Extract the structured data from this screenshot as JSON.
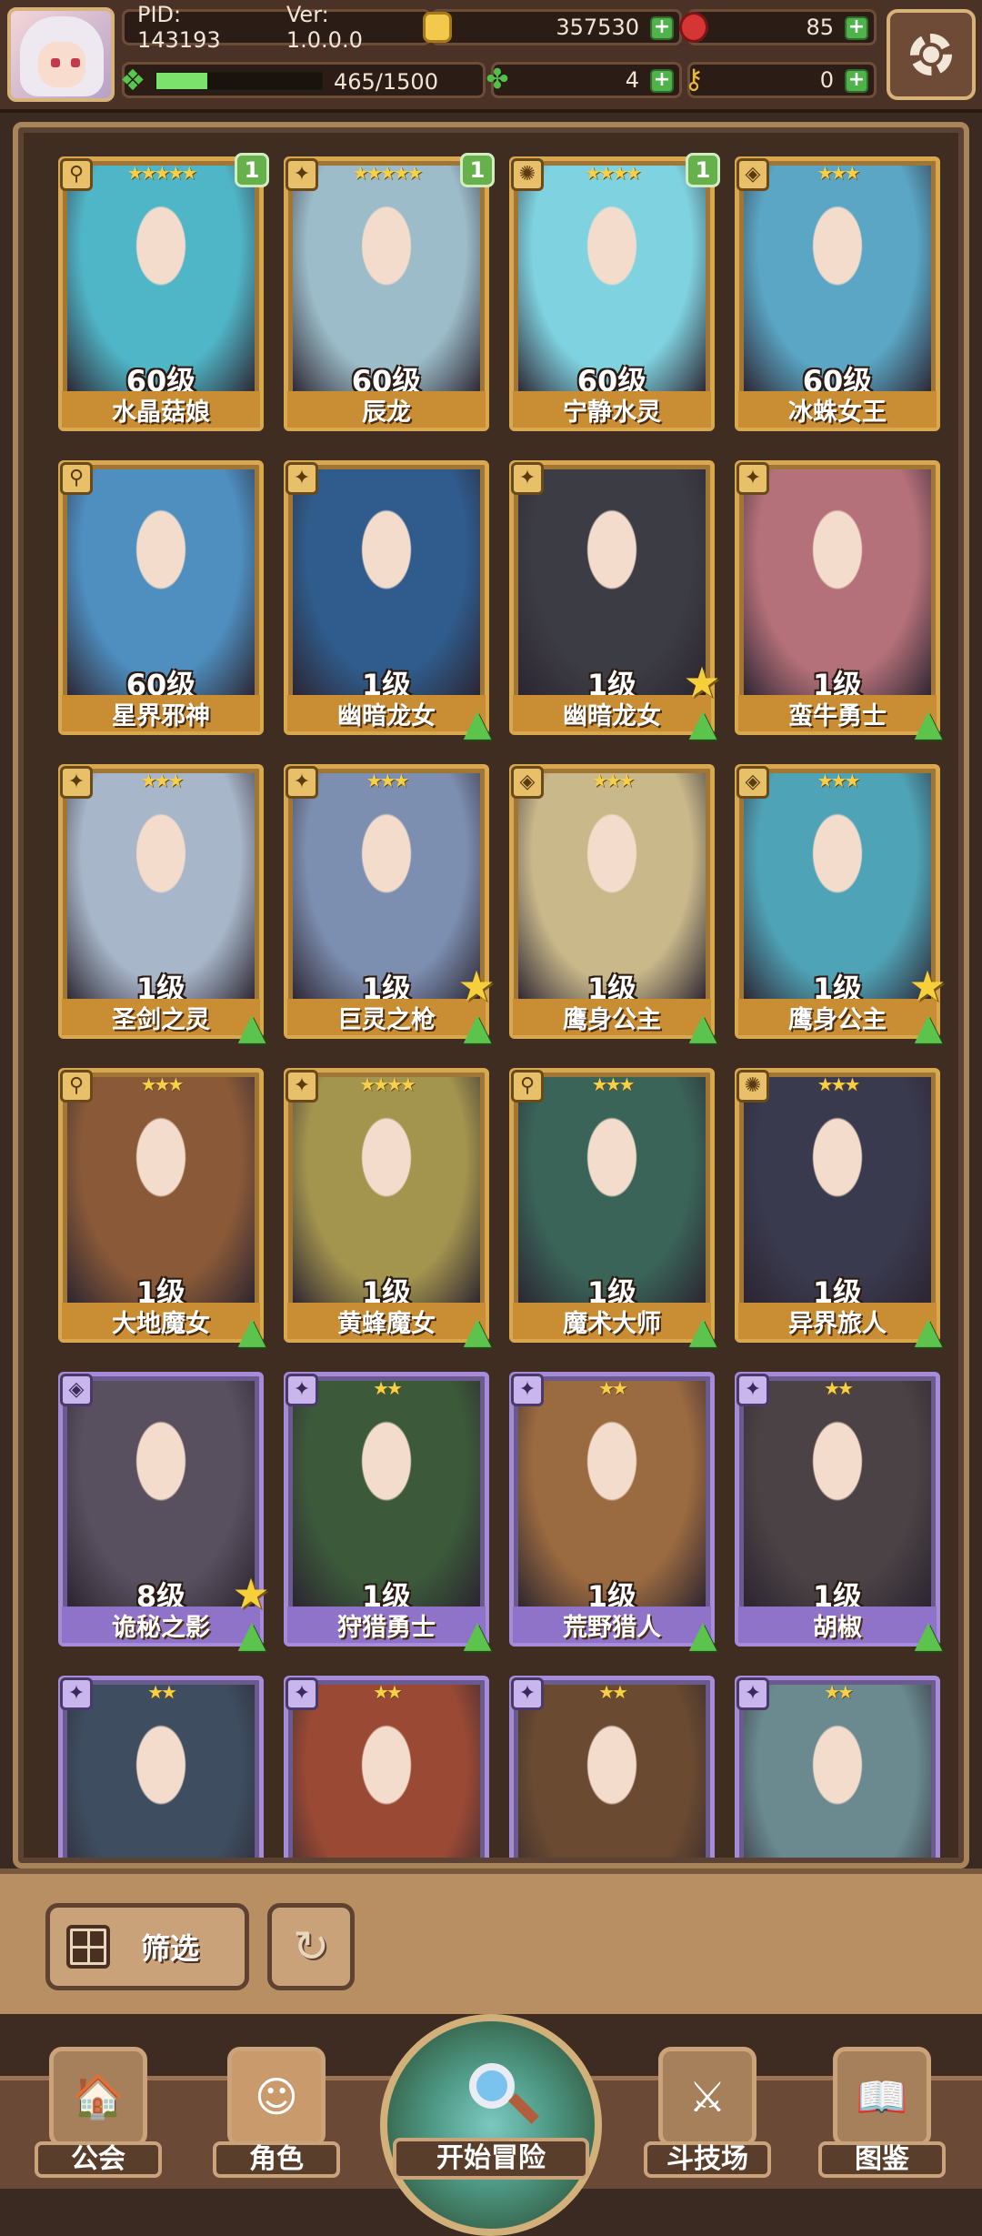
{
  "header": {
    "pid_label": "PID: 143193",
    "version_label": "Ver: 1.0.0.0",
    "coins": "357530",
    "gems": "85",
    "energy": "465/1500",
    "energy_fraction": 0.31,
    "clovers": "4",
    "keys": "0",
    "icons": {
      "coin": "coin-icon",
      "gem": "gem-icon",
      "energy": "leaf-icon",
      "clover": "clover-icon",
      "key": "key-icon",
      "settings": "gear-icon"
    }
  },
  "cards": [
    {
      "name": "水晶菇娘",
      "level": "60级",
      "stars": 5,
      "badge": "1",
      "role": "wand",
      "color": "gold",
      "tint": "#4fb6c7",
      "up": false,
      "bigstar": false
    },
    {
      "name": "辰龙",
      "level": "60级",
      "stars": 5,
      "badge": "1",
      "role": "sword",
      "color": "gold",
      "tint": "#9bbcc8",
      "up": false,
      "bigstar": false
    },
    {
      "name": "宁静水灵",
      "level": "60级",
      "stars": 4,
      "badge": "1",
      "role": "orb",
      "color": "gold",
      "tint": "#7fd3e0",
      "up": false,
      "bigstar": false
    },
    {
      "name": "冰蛛女王",
      "level": "60级",
      "stars": 3,
      "badge": "",
      "role": "leaf",
      "color": "gold",
      "tint": "#5aa6c4",
      "up": false,
      "bigstar": false
    },
    {
      "name": "星界邪神",
      "level": "60级",
      "stars": 0,
      "badge": "",
      "role": "wand",
      "color": "gold",
      "tint": "#4e8fc0",
      "up": false,
      "bigstar": false
    },
    {
      "name": "幽暗龙女",
      "level": "1级",
      "stars": 0,
      "badge": "",
      "role": "sword",
      "color": "gold",
      "tint": "#2f5c8c",
      "up": true,
      "bigstar": false
    },
    {
      "name": "幽暗龙女",
      "level": "1级",
      "stars": 0,
      "badge": "",
      "role": "sword",
      "color": "gold",
      "tint": "#3c3c44",
      "up": true,
      "bigstar": true
    },
    {
      "name": "蛮牛勇士",
      "level": "1级",
      "stars": 0,
      "badge": "",
      "role": "sword",
      "color": "gold",
      "tint": "#b5717a",
      "up": true,
      "bigstar": false
    },
    {
      "name": "圣剑之灵",
      "level": "1级",
      "stars": 3,
      "badge": "",
      "role": "sword",
      "color": "gold",
      "tint": "#a7b6c8",
      "up": true,
      "bigstar": false
    },
    {
      "name": "巨灵之枪",
      "level": "1级",
      "stars": 3,
      "badge": "",
      "role": "sword",
      "color": "gold",
      "tint": "#7d8fb0",
      "up": true,
      "bigstar": true
    },
    {
      "name": "鹰身公主",
      "level": "1级",
      "stars": 3,
      "badge": "",
      "role": "leaf",
      "color": "gold",
      "tint": "#c9b88a",
      "up": true,
      "bigstar": false
    },
    {
      "name": "鹰身公主",
      "level": "1级",
      "stars": 3,
      "badge": "",
      "role": "leaf",
      "color": "gold",
      "tint": "#4fa3b6",
      "up": true,
      "bigstar": true
    },
    {
      "name": "大地魔女",
      "level": "1级",
      "stars": 3,
      "badge": "",
      "role": "wand",
      "color": "gold",
      "tint": "#8a5a38",
      "up": true,
      "bigstar": false
    },
    {
      "name": "黄蜂魔女",
      "level": "1级",
      "stars": 4,
      "badge": "",
      "role": "sword",
      "color": "gold",
      "tint": "#a3944e",
      "up": true,
      "bigstar": false
    },
    {
      "name": "魔术大师",
      "level": "1级",
      "stars": 3,
      "badge": "",
      "role": "wand",
      "color": "gold",
      "tint": "#3a6458",
      "up": true,
      "bigstar": false
    },
    {
      "name": "异界旅人",
      "level": "1级",
      "stars": 3,
      "badge": "",
      "role": "orb",
      "color": "gold",
      "tint": "#3a3a4e",
      "up": true,
      "bigstar": false
    },
    {
      "name": "诡秘之影",
      "level": "8级",
      "stars": 0,
      "badge": "",
      "role": "leaf",
      "color": "purple",
      "tint": "#58505e",
      "up": true,
      "bigstar": true
    },
    {
      "name": "狩猎勇士",
      "level": "1级",
      "stars": 2,
      "badge": "",
      "role": "sword",
      "color": "purple",
      "tint": "#3c5a3a",
      "up": true,
      "bigstar": false
    },
    {
      "name": "荒野猎人",
      "level": "1级",
      "stars": 2,
      "badge": "",
      "role": "sword",
      "color": "purple",
      "tint": "#9a6a40",
      "up": true,
      "bigstar": false
    },
    {
      "name": "胡椒",
      "level": "1级",
      "stars": 2,
      "badge": "",
      "role": "sword",
      "color": "purple",
      "tint": "#4a4244",
      "up": true,
      "bigstar": false
    },
    {
      "name": "",
      "level": "",
      "stars": 2,
      "badge": "",
      "role": "sword",
      "color": "purple",
      "tint": "#3e4e60",
      "up": false,
      "bigstar": false
    },
    {
      "name": "",
      "level": "",
      "stars": 2,
      "badge": "",
      "role": "sword",
      "color": "purple",
      "tint": "#9a4a34",
      "up": false,
      "bigstar": false
    },
    {
      "name": "",
      "level": "",
      "stars": 2,
      "badge": "",
      "role": "sword",
      "color": "purple",
      "tint": "#6a4a30",
      "up": false,
      "bigstar": false
    },
    {
      "name": "",
      "level": "",
      "stars": 2,
      "badge": "",
      "role": "sword",
      "color": "purple",
      "tint": "#6a8a90",
      "up": false,
      "bigstar": false
    }
  ],
  "controls": {
    "filter_label": "筛选",
    "filter_icon": "grid-icon",
    "reset_icon": "refresh-icon"
  },
  "nav": {
    "guild": "公会",
    "characters": "角色",
    "adventure": "开始冒险",
    "arena": "斗技场",
    "codex": "图鉴"
  }
}
